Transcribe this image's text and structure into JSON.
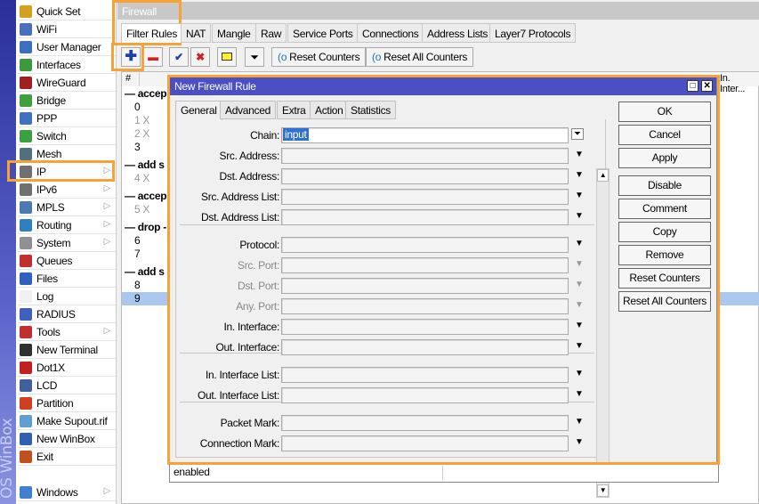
{
  "brand_vertical": "OS WinBox",
  "sidebar": {
    "items": [
      {
        "label": "Quick Set",
        "icon": "wand-icon",
        "color": "#d4a020",
        "arrow": false
      },
      {
        "label": "WiFi",
        "icon": "wifi-icon",
        "color": "#4a6fbf",
        "arrow": false
      },
      {
        "label": "User Manager",
        "icon": "user-manager-icon",
        "color": "#3b6fc0",
        "arrow": false
      },
      {
        "label": "Interfaces",
        "icon": "interfaces-icon",
        "color": "#3c9a3c",
        "arrow": false
      },
      {
        "label": "WireGuard",
        "icon": "wireguard-icon",
        "color": "#a02020",
        "arrow": false
      },
      {
        "label": "Bridge",
        "icon": "bridge-icon",
        "color": "#40a040",
        "arrow": false
      },
      {
        "label": "PPP",
        "icon": "ppp-icon",
        "color": "#4070c0",
        "arrow": false
      },
      {
        "label": "Switch",
        "icon": "switch-icon",
        "color": "#3aa040",
        "arrow": false
      },
      {
        "label": "Mesh",
        "icon": "mesh-icon",
        "color": "#507080",
        "arrow": false
      },
      {
        "label": "IP",
        "icon": "ip-icon",
        "color": "#707070",
        "arrow": true
      },
      {
        "label": "IPv6",
        "icon": "ipv6-icon",
        "color": "#707070",
        "arrow": true
      },
      {
        "label": "MPLS",
        "icon": "mpls-icon",
        "color": "#4a7ab0",
        "arrow": true
      },
      {
        "label": "Routing",
        "icon": "routing-icon",
        "color": "#3080c0",
        "arrow": true
      },
      {
        "label": "System",
        "icon": "gear-icon",
        "color": "#909090",
        "arrow": true
      },
      {
        "label": "Queues",
        "icon": "queues-icon",
        "color": "#c03030",
        "arrow": false
      },
      {
        "label": "Files",
        "icon": "files-icon",
        "color": "#3060c0",
        "arrow": false
      },
      {
        "label": "Log",
        "icon": "log-icon",
        "color": "#f0f0f0",
        "arrow": false
      },
      {
        "label": "RADIUS",
        "icon": "radius-icon",
        "color": "#4060c0",
        "arrow": false
      },
      {
        "label": "Tools",
        "icon": "tools-icon",
        "color": "#c03030",
        "arrow": true
      },
      {
        "label": "New Terminal",
        "icon": "terminal-icon",
        "color": "#303030",
        "arrow": false
      },
      {
        "label": "Dot1X",
        "icon": "dot1x-icon",
        "color": "#c02020",
        "arrow": false
      },
      {
        "label": "LCD",
        "icon": "lcd-icon",
        "color": "#4060a0",
        "arrow": false
      },
      {
        "label": "Partition",
        "icon": "partition-icon",
        "color": "#d04020",
        "arrow": false
      },
      {
        "label": "Make Supout.rif",
        "icon": "supout-icon",
        "color": "#60a0d0",
        "arrow": false
      },
      {
        "label": "New WinBox",
        "icon": "winbox-icon",
        "color": "#3060b0",
        "arrow": false
      },
      {
        "label": "Exit",
        "icon": "exit-icon",
        "color": "#c05020",
        "arrow": false
      },
      {
        "label": "Windows",
        "icon": "windows-icon",
        "color": "#4080d0",
        "arrow": true
      }
    ]
  },
  "firewall": {
    "title": "Firewall",
    "tabs": [
      "Filter Rules",
      "NAT",
      "Mangle",
      "Raw",
      "Service Ports",
      "Connections",
      "Address Lists",
      "Layer7 Protocols"
    ],
    "toolbar": {
      "reset_counters": "Reset Counters",
      "reset_all_counters": "Reset All Counters"
    },
    "table": {
      "headers": [
        "#",
        "In. Inter..."
      ],
      "rows": [
        {
          "text": "— accep",
          "type": "grp"
        },
        {
          "text": "0",
          "type": ""
        },
        {
          "text": "1 X",
          "type": "dis"
        },
        {
          "text": "2 X",
          "type": "dis"
        },
        {
          "text": "3",
          "type": ""
        },
        {
          "text": "— add s",
          "type": "grp"
        },
        {
          "text": "4 X",
          "type": "dis"
        },
        {
          "text": "— accep",
          "type": "grp"
        },
        {
          "text": "5 X",
          "type": "dis"
        },
        {
          "text": "— drop -",
          "type": "grp"
        },
        {
          "text": "6",
          "type": ""
        },
        {
          "text": "7",
          "type": ""
        },
        {
          "text": "— add s",
          "type": "grp"
        },
        {
          "text": "8",
          "type": ""
        },
        {
          "text": "9",
          "type": "sel"
        }
      ]
    }
  },
  "dialog": {
    "title": "New Firewall Rule",
    "tabs": [
      "General",
      "Advanced",
      "Extra",
      "Action",
      "Statistics"
    ],
    "fields": [
      {
        "label": "Chain:",
        "value": "input"
      },
      {
        "label": "Src. Address:",
        "value": ""
      },
      {
        "label": "Dst. Address:",
        "value": ""
      },
      {
        "label": "Src. Address List:",
        "value": ""
      },
      {
        "label": "Dst. Address List:",
        "value": ""
      },
      {
        "label": "Protocol:",
        "value": ""
      },
      {
        "label": "Src. Port:",
        "value": "",
        "disabled": true
      },
      {
        "label": "Dst. Port:",
        "value": "",
        "disabled": true
      },
      {
        "label": "Any. Port:",
        "value": "",
        "disabled": true
      },
      {
        "label": "In. Interface:",
        "value": ""
      },
      {
        "label": "Out. Interface:",
        "value": ""
      },
      {
        "label": "In. Interface List:",
        "value": ""
      },
      {
        "label": "Out. Interface List:",
        "value": ""
      },
      {
        "label": "Packet Mark:",
        "value": ""
      },
      {
        "label": "Connection Mark:",
        "value": ""
      }
    ],
    "buttons": [
      "OK",
      "Cancel",
      "Apply",
      "Disable",
      "Comment",
      "Copy",
      "Remove",
      "Reset Counters",
      "Reset All Counters"
    ],
    "status": "enabled"
  },
  "colors": {
    "highlight": "#f7a234",
    "title_bar": "#4a4fc6",
    "selection": "#aac8ee"
  }
}
